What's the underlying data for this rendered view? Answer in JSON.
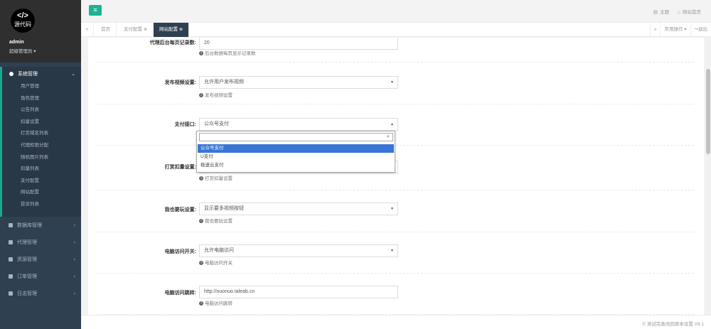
{
  "sidebar": {
    "logo_code": "</>",
    "logo_text": "源代码",
    "user_name": "admin",
    "user_role": "超级管理员 ▾",
    "open_menu": {
      "label": "系统管理",
      "items": [
        "用户管理",
        "角色管理",
        "公告列表",
        "扣量设置",
        "打赏域名列表",
        "代理权限分配",
        "随机图片列表",
        "扣量列表",
        "支付配置",
        "网站配置",
        "投诉列表"
      ]
    },
    "menus": [
      "数据库管理",
      "代理管理",
      "资源管理",
      "订单管理",
      "日志管理"
    ]
  },
  "topbar": {
    "theme": "主题",
    "home": "网站首页"
  },
  "tabs": {
    "items": [
      {
        "label": "首页"
      },
      {
        "label": "支付配置"
      },
      {
        "label": "网站配置"
      }
    ],
    "ops": "常用操作 ▾",
    "logout": "退出"
  },
  "form": {
    "rows": [
      {
        "label": "代理后台每页记录数:",
        "value": "20",
        "help": "后台数据每页显示记录数"
      },
      {
        "label": "发布视频设置:",
        "value": "允许用户发布视频",
        "help": "发布视频设置"
      },
      {
        "label": "支付接口:",
        "value": "公众号支付",
        "help": ""
      },
      {
        "label": "打赏扣量设置:",
        "value": "",
        "help": "打赏扣量设置"
      },
      {
        "label": "我也要玩设置:",
        "value": "显示要多视频按钮",
        "help": "我也要玩设置"
      },
      {
        "label": "电脑访问开关:",
        "value": "允许电脑访问",
        "help": "电脑访问开关"
      },
      {
        "label": "电脑访问跳转:",
        "value": "http://nuonuo.taleab.cn",
        "help": "电脑访问跳转"
      }
    ],
    "dropdown_options": [
      "公众号支付",
      "U支付",
      "极速云支付"
    ]
  },
  "footer": "© 测试完善改回原本设置 V9.1"
}
